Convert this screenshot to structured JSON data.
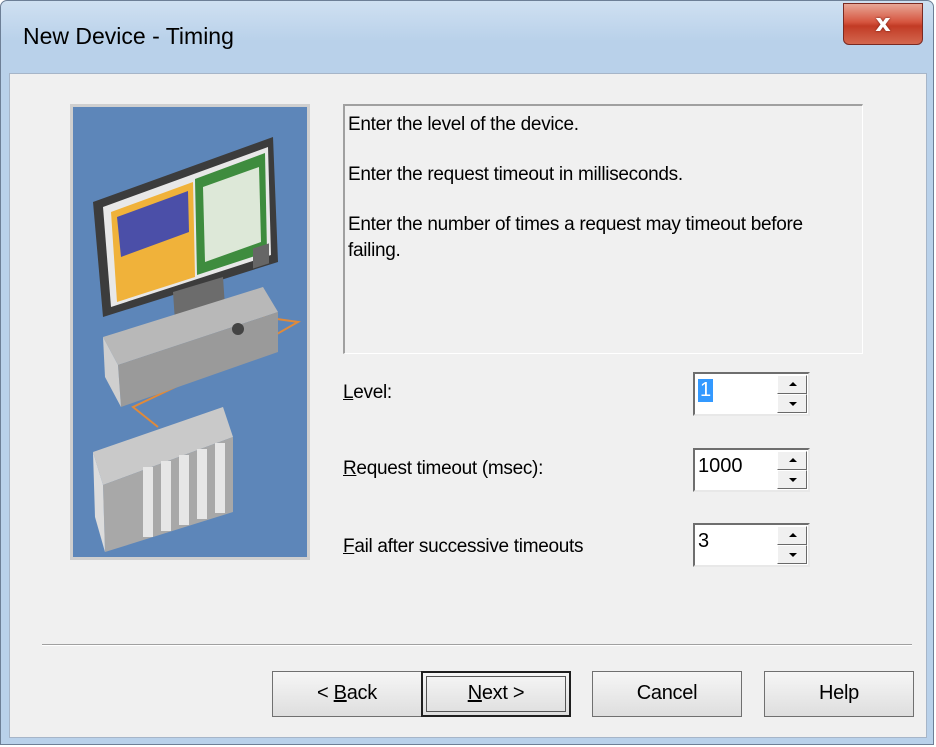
{
  "window": {
    "title": "New Device - Timing",
    "close_glyph": "x"
  },
  "description": {
    "line1": "Enter the level of the device.",
    "line2": "Enter the request timeout in milliseconds.",
    "line3": "Enter the number of times a request may timeout before failing."
  },
  "fields": {
    "level": {
      "label_accel": "L",
      "label_rest": "evel:",
      "value": "1"
    },
    "request_timeout": {
      "label_accel": "R",
      "label_rest": "equest timeout (msec):",
      "value": "1000"
    },
    "fail_after": {
      "label_accel": "F",
      "label_rest": "ail after successive timeouts",
      "value": "3"
    }
  },
  "buttons": {
    "back": {
      "prefix": "< ",
      "accel": "B",
      "rest": "ack"
    },
    "next": {
      "accel": "N",
      "rest": "ext >"
    },
    "cancel": "Cancel",
    "help": "Help"
  },
  "colors": {
    "illustration_bg": "#5d86b9",
    "selection": "#3399ff",
    "close_button": "#c94330"
  },
  "icons": [
    "close-icon",
    "spin-up-icon",
    "spin-down-icon",
    "computer-plc-illustration"
  ]
}
